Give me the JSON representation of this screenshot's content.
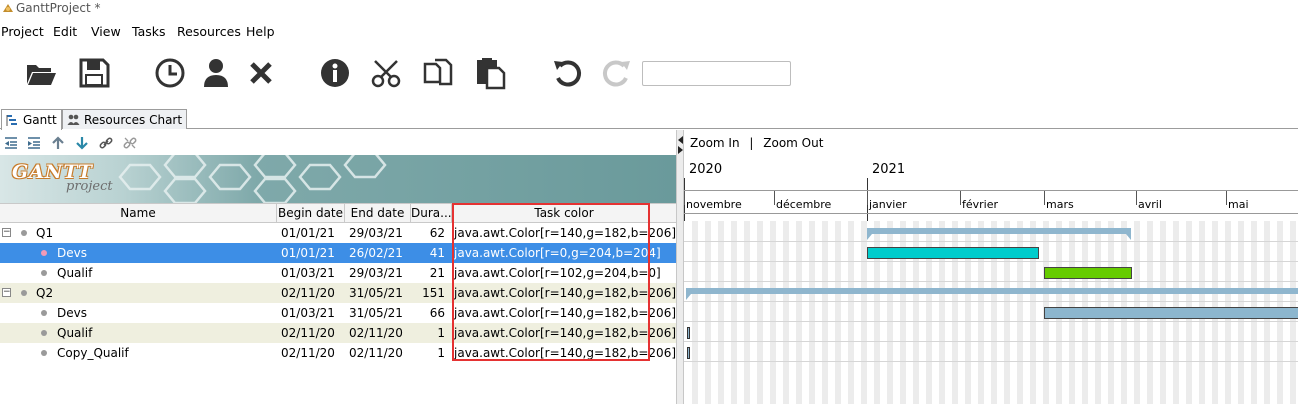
{
  "window": {
    "title": "GanttProject *"
  },
  "menu": [
    "Project",
    "Edit",
    "View",
    "Tasks",
    "Resources",
    "Help"
  ],
  "toolbar": {
    "icons": [
      "open-folder-icon",
      "save-icon",
      "clock-icon",
      "person-icon",
      "delete-icon",
      "info-icon",
      "cut-icon",
      "copy-icon",
      "paste-icon",
      "undo-icon",
      "redo-icon"
    ],
    "search_placeholder": ""
  },
  "tabs": [
    {
      "label": "Gantt",
      "active": true
    },
    {
      "label": "Resources Chart",
      "active": false
    }
  ],
  "task_toolbar_icons": [
    "unindent-icon",
    "indent-icon",
    "move-up-icon",
    "move-down-icon",
    "link-icon",
    "unlink-icon"
  ],
  "banner": {
    "logo_text": "GANTT",
    "logo_sub": "project"
  },
  "table": {
    "columns": [
      "Name",
      "Begin date",
      "End date",
      "Dura...",
      "Task color"
    ],
    "rows": [
      {
        "name": "Q1",
        "begin": "01/01/21",
        "end": "29/03/21",
        "duration": "62",
        "color": "java.awt.Color[r=140,g=182,b=206]",
        "level": 0,
        "group": true,
        "selected": false
      },
      {
        "name": "Devs",
        "begin": "01/01/21",
        "end": "26/02/21",
        "duration": "41",
        "color": "java.awt.Color[r=0,g=204,b=204]",
        "level": 1,
        "group": false,
        "selected": true
      },
      {
        "name": "Qualif",
        "begin": "01/03/21",
        "end": "29/03/21",
        "duration": "21",
        "color": "java.awt.Color[r=102,g=204,b=0]",
        "level": 1,
        "group": false,
        "selected": false
      },
      {
        "name": "Q2",
        "begin": "02/11/20",
        "end": "31/05/21",
        "duration": "151",
        "color": "java.awt.Color[r=140,g=182,b=206]",
        "level": 0,
        "group": true,
        "selected": false
      },
      {
        "name": "Devs",
        "begin": "01/03/21",
        "end": "31/05/21",
        "duration": "66",
        "color": "java.awt.Color[r=140,g=182,b=206]",
        "level": 1,
        "group": false,
        "selected": false
      },
      {
        "name": "Qualif",
        "begin": "02/11/20",
        "end": "02/11/20",
        "duration": "1",
        "color": "java.awt.Color[r=140,g=182,b=206]",
        "level": 1,
        "group": false,
        "selected": false
      },
      {
        "name": "Copy_Qualif",
        "begin": "02/11/20",
        "end": "02/11/20",
        "duration": "1",
        "color": "java.awt.Color[r=140,g=182,b=206]",
        "level": 1,
        "group": false,
        "selected": false
      }
    ]
  },
  "chart": {
    "zoom_in": "Zoom In",
    "separator": "|",
    "zoom_out": "Zoom Out",
    "years": [
      "2020",
      "2021"
    ],
    "months": [
      "novembre",
      "décembre",
      "janvier",
      "février",
      "mars",
      "avril",
      "mai"
    ],
    "task_colors": {
      "summary": "#8cb6ce",
      "devs_q1": "#00cccc",
      "qualif_q1": "#66cc00",
      "devs_q2": "#8cb6ce"
    }
  }
}
